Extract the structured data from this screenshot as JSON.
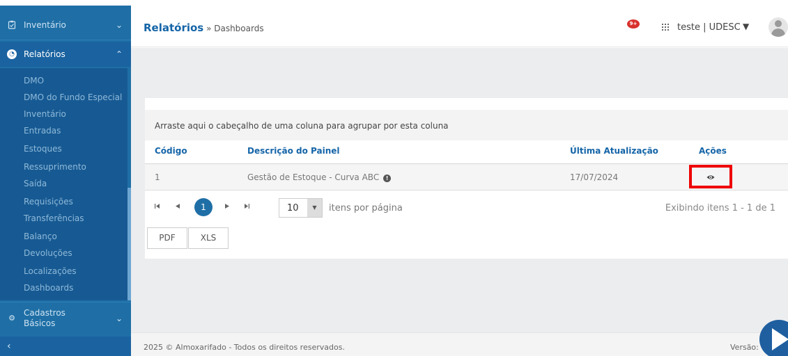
{
  "sidebar": {
    "inventario": "Inventário",
    "relatorios": "Relatórios",
    "submenu": [
      "DMO",
      "DMO do Fundo Especial",
      "Inventário",
      "Entradas",
      "Estoques",
      "Ressuprimento",
      "Saída",
      "Requisições",
      "Transferências",
      "Balanço",
      "Devoluções",
      "Localizações",
      "Dashboards"
    ],
    "cadastros_line1": "Cadastros",
    "cadastros_line2": "Básicos",
    "collapse": "‹"
  },
  "header": {
    "title": "Relatórios",
    "crumb": " » Dashboards",
    "notif_badge": "9+",
    "grid_icon": "grid-icon",
    "user": "teste | UDESC",
    "user_caret": "▼"
  },
  "grid": {
    "group_hint": "Arraste aqui o cabeçalho de uma coluna para agrupar por esta coluna",
    "columns": [
      "Código",
      "Descrição do Painel",
      "Última Atualização",
      "Ações"
    ],
    "rows": [
      {
        "codigo": "1",
        "descricao": "Gestão de Estoque - Curva ABC",
        "atualizacao": "17/07/2024"
      }
    ],
    "info_glyph": "!",
    "eye_glyph": "👁",
    "current_page": "1",
    "page_size": "10",
    "page_size_label": "itens por página",
    "page_info": "Exibindo itens 1 - 1 de 1",
    "first_glyph": "⏮",
    "prev_glyph": "◀",
    "next_glyph": "▶",
    "last_glyph": "⏭",
    "dd_glyph": "▼",
    "export_pdf": "PDF",
    "export_xls": "XLS"
  },
  "footer": {
    "copyright": "2025 © Almoxarifado - Todos os direitos reservados.",
    "version": "Versão:"
  },
  "colors": {
    "sidebar": "#1f6fa6",
    "accent": "#1565a8",
    "highlight": "#ee0000"
  }
}
